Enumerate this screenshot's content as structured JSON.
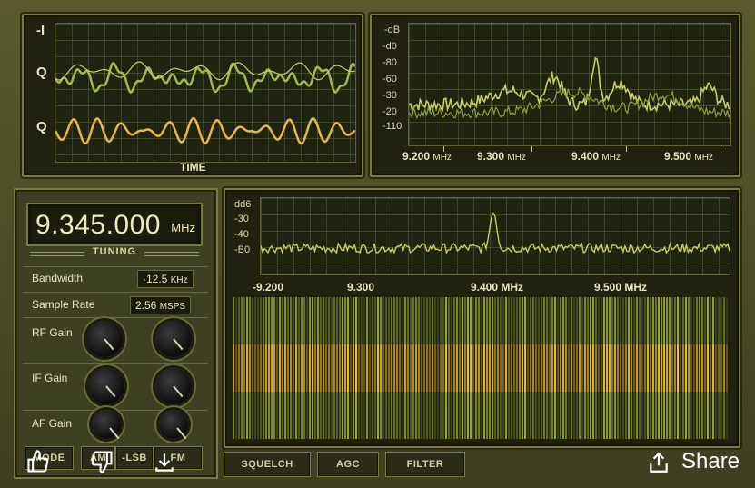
{
  "iq_panel": {
    "label_i": "-I",
    "label_q1": "Q",
    "label_q2": "Q",
    "time_label": "TIME"
  },
  "spectrum_top": {
    "db_label": "-dB",
    "db_ticks": [
      "-d0",
      "-80",
      "-60",
      "-30",
      "-20",
      "-110"
    ],
    "freq_ticks": [
      {
        "num": "9.200",
        "unit": "MHz"
      },
      {
        "num": "9.300",
        "unit": "MHz"
      },
      {
        "num": "9.400",
        "unit": "MHz"
      },
      {
        "num": "9.500",
        "unit": "MHz"
      }
    ]
  },
  "spectrum_bottom": {
    "db_label": "dd6",
    "db_ticks": [
      "-30",
      "-40",
      "-B0"
    ],
    "freq_ticks": [
      "-9.200",
      "9.300",
      "9.400 MHz",
      "9.500 MHz"
    ]
  },
  "tuning": {
    "frequency": "9.345.000",
    "unit": "MHz",
    "label": "TUNING"
  },
  "controls": {
    "bandwidth_label": "Bandwidth",
    "bandwidth_value": "·12.5",
    "bandwidth_unit": "KHz",
    "sample_rate_label": "Sample Rate",
    "sample_rate_value": "2.56",
    "sample_rate_unit": "MSPS",
    "rf_gain_label": "RF Gain",
    "if_gain_label": "IF Gain",
    "af_gain_label": "AF Gain"
  },
  "mode_buttons": [
    "MODE",
    "AM",
    "-LSB",
    "FM"
  ],
  "bottom_buttons": [
    "SQUELCH",
    "AGC",
    "FILTER"
  ],
  "overlay": {
    "share_label": "Share",
    "icons": [
      "thumbs-up-icon",
      "thumbs-down-icon",
      "download-icon",
      "share-icon"
    ]
  },
  "colors": {
    "trace_green": "#a4b94d",
    "trace_amber": "#e6b84a",
    "accent": "#e4d55a"
  }
}
